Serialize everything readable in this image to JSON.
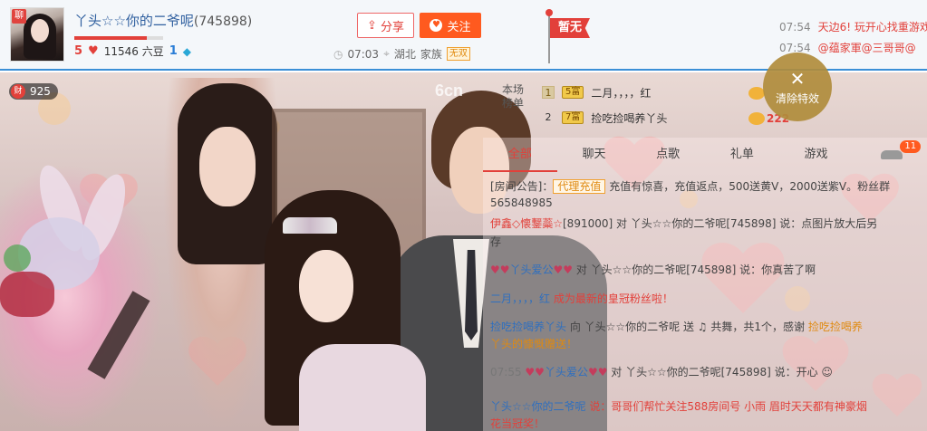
{
  "header": {
    "avatar_badge": "聊",
    "streamer_name": "丫头☆☆你的二爷呢",
    "room_id": "(745898)",
    "level_red": "5",
    "beans": "11546 六豆",
    "level_blue": "1",
    "share_label": "分享",
    "follow_label": "关注",
    "time": "07:03",
    "location": "湖北",
    "family_label": "家族",
    "family_badge": "无双",
    "flag_label": "暂无",
    "level_progress": 0.82
  },
  "ticker": [
    {
      "time": "07:54",
      "text": "天边6! 玩开心找重游戏"
    },
    {
      "time": "07:54",
      "text": "@蕴家軍@三哥哥@"
    }
  ],
  "stage": {
    "wealth_icon": "财",
    "wealth_count": "925",
    "watermark": "6cn"
  },
  "ranking": {
    "label": "本场榜单",
    "rows": [
      {
        "rank": "1",
        "badge": "5富",
        "name": "二月，，，，红",
        "value": ""
      },
      {
        "rank": "2",
        "badge": "7富",
        "name": "捡吃捡喝养丫头",
        "value": "222"
      }
    ]
  },
  "clear_effects": {
    "label": "清除特效"
  },
  "chat": {
    "tabs": [
      "全部",
      "聊天",
      "点歌",
      "礼单",
      "游戏"
    ],
    "car_count": "11",
    "messages": [
      {
        "prefix": "[房间公告]：",
        "tag": "代理充值",
        "text": "充值有惊喜，充值返点，500送黄V，2000送紫V。粉丝群"
      },
      {
        "text": "565848985"
      },
      {
        "nick": "伊鑫◇懐鑋蘂☆",
        "text": "[891000] 对 丫头☆☆你的二爷呢[745898] 说：点图片放大后另"
      },
      {
        "text": "存"
      },
      {
        "hearts": "♥♥",
        "nick": "丫头爱公",
        "hearts2": "♥♥",
        "text": " 对 丫头☆☆你的二爷呢[745898] 说：你真苦了啊"
      },
      {
        "nick": "二月，，，，红",
        "red": "成为最新的皇冠粉丝啦！"
      },
      {
        "nick": "捡吃捡喝养丫头",
        "text": " 向 丫头☆☆你的二爷呢 送 ",
        "gift": "共舞，共1个，感谢 ",
        "orange": "捡吃捡喝养"
      },
      {
        "orange": "丫头的慷慨赠送！"
      },
      {
        "time": "07:55",
        "hearts": "♥♥",
        "nick": "丫头爱公",
        "hearts2": "♥♥",
        "text": " 对 丫头☆☆你的二爷呢[745898] 说：开心"
      },
      {
        "nick": "丫头☆☆你的二爷呢",
        "red": "说：哥哥们帮忙关注588房间号 小雨 眉时天天都有神豪烟"
      },
      {
        "red": "花当冠奖！"
      }
    ]
  },
  "colors": {
    "accent_red": "#e2403a",
    "follow_orange": "#ff5a1f",
    "header_border": "#3a8fd6",
    "clear_gold": "#b08c3c"
  }
}
